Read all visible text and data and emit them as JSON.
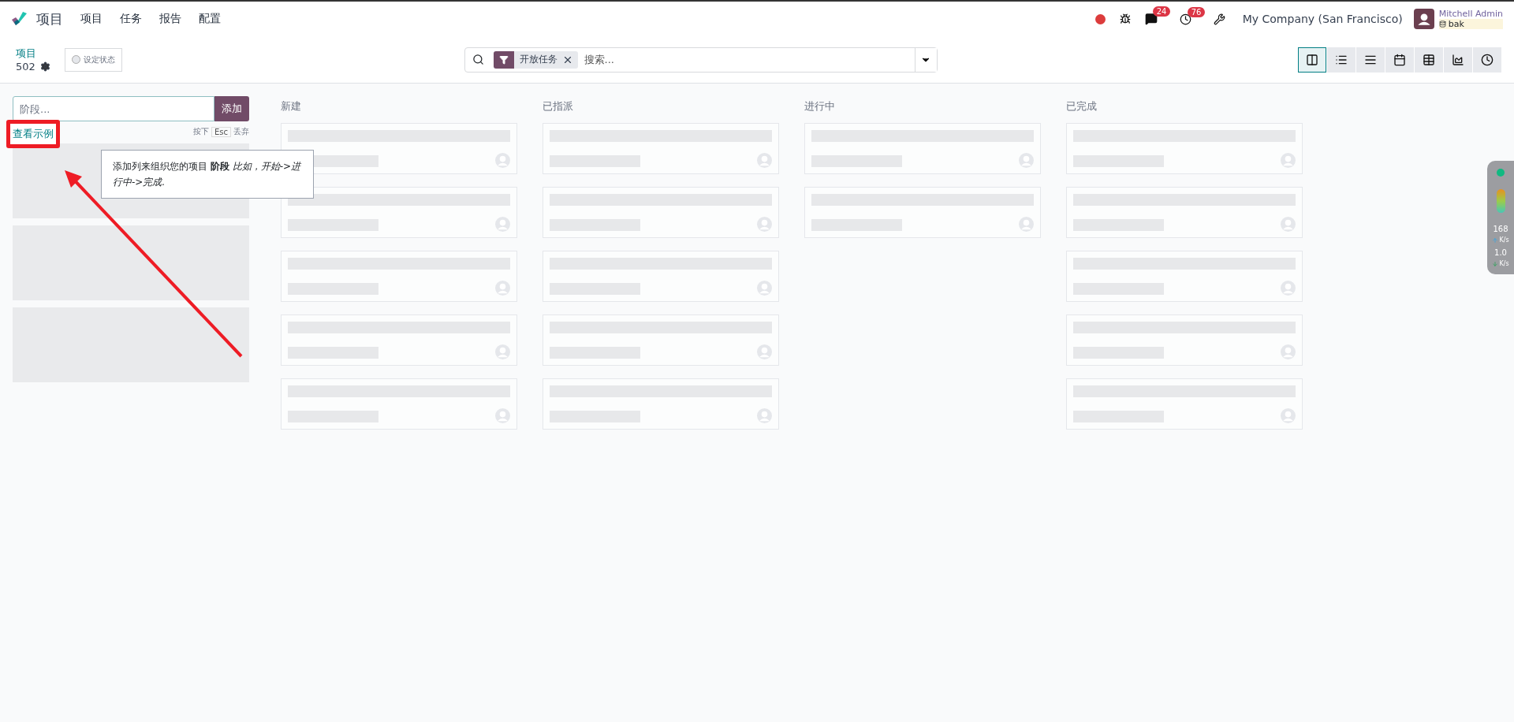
{
  "navbar": {
    "app_title": "项目",
    "menu": [
      "项目",
      "任务",
      "报告",
      "配置"
    ],
    "message_count": "24",
    "activity_count": "76",
    "company": "My Company (San Francisco)",
    "user_name": "Mitchell Admin",
    "database": "bak"
  },
  "control_panel": {
    "breadcrumb": "项目",
    "record_count": "502",
    "status_button": "设定状态",
    "search": {
      "facet": "开放任务",
      "placeholder": "搜索..."
    },
    "views": [
      {
        "kind": "kanban",
        "selected": true
      },
      {
        "kind": "list",
        "selected": false
      },
      {
        "kind": "gantt",
        "selected": false
      },
      {
        "kind": "calendar",
        "selected": false
      },
      {
        "kind": "pivot",
        "selected": false
      },
      {
        "kind": "graph",
        "selected": false
      },
      {
        "kind": "activity",
        "selected": false
      }
    ]
  },
  "stage_form": {
    "placeholder": "阶段...",
    "add_button": "添加",
    "examples_link": "查看示例",
    "hint": [
      "按下",
      "Esc",
      "丢弃"
    ],
    "tooltip": "添加列来组织您的项目 **阶段** *比如，开始->进行中->完成.*"
  },
  "columns": [
    {
      "title": "新建",
      "cards": [
        {
          "kind": "placeholder"
        },
        {
          "kind": "placeholder"
        },
        {
          "kind": "placeholder"
        },
        {
          "kind": "placeholder"
        },
        {
          "kind": "placeholder"
        }
      ]
    },
    {
      "title": "已指派",
      "cards": [
        {
          "kind": "placeholder"
        },
        {
          "kind": "placeholder"
        },
        {
          "kind": "placeholder"
        },
        {
          "kind": "placeholder"
        },
        {
          "kind": "placeholder"
        }
      ]
    },
    {
      "title": "进行中",
      "cards": [
        {
          "kind": "placeholder"
        },
        {
          "kind": "placeholder"
        }
      ]
    },
    {
      "title": "已完成",
      "cards": [
        {
          "kind": "placeholder"
        },
        {
          "kind": "placeholder"
        },
        {
          "kind": "placeholder"
        },
        {
          "kind": "placeholder"
        },
        {
          "kind": "placeholder"
        }
      ]
    }
  ],
  "network_widget": {
    "upload": "168",
    "upload_unit": "K/s",
    "download": "1.0",
    "download_unit": "K/s"
  }
}
